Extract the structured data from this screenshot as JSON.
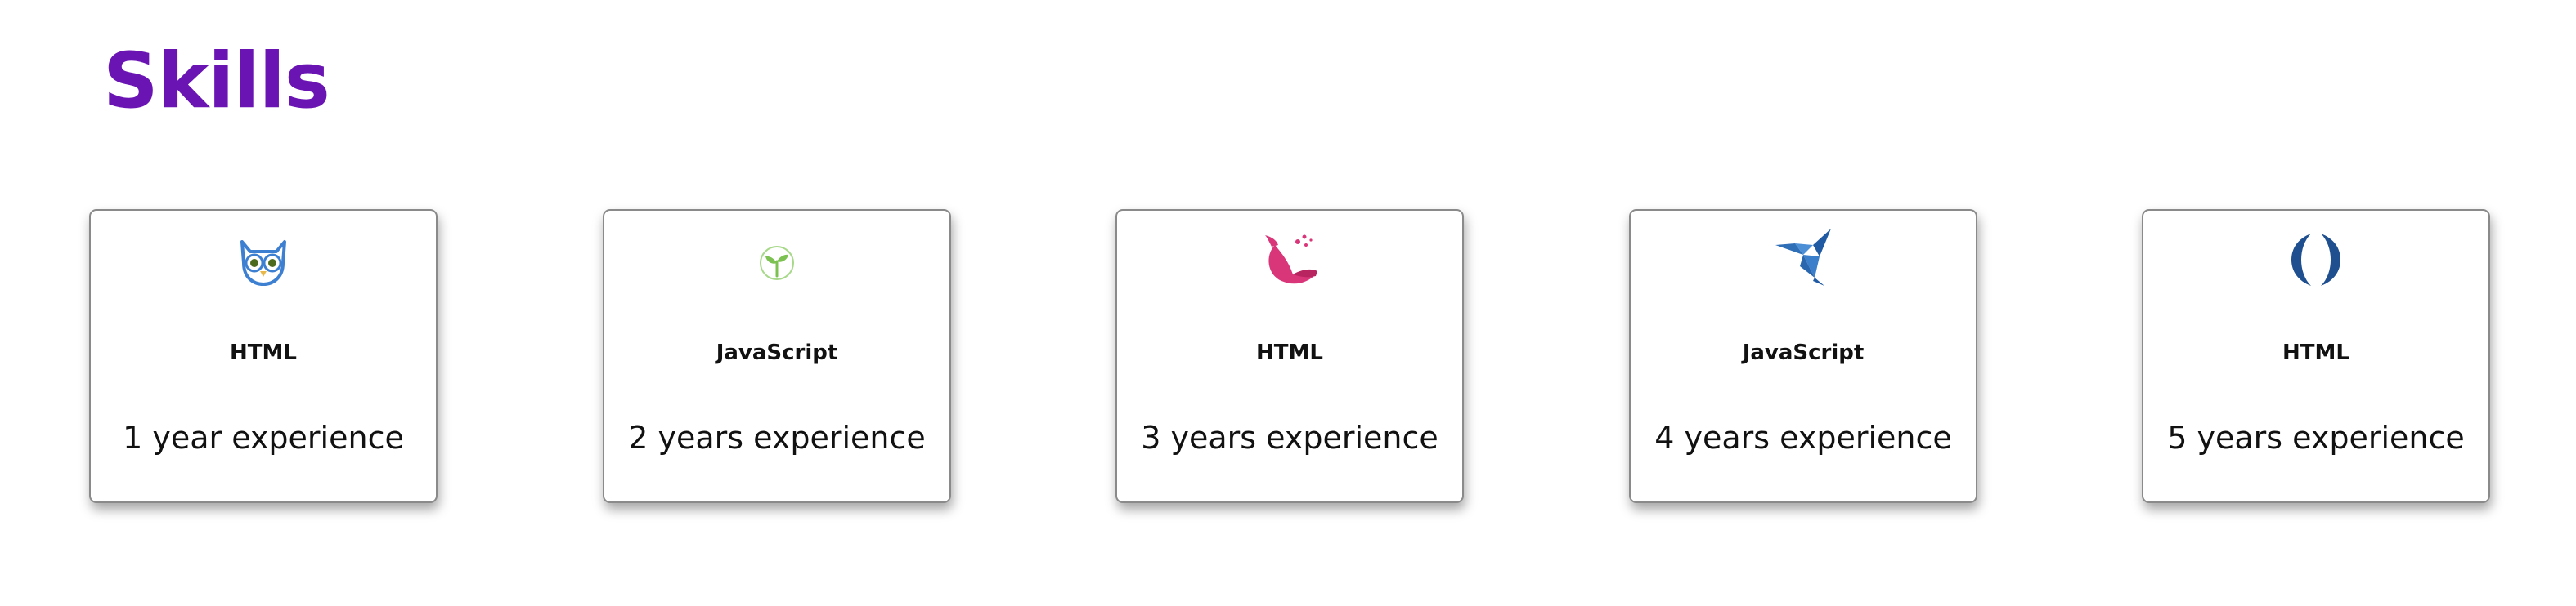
{
  "page": {
    "title": "Skills",
    "title_color": "#6a14b4"
  },
  "cards": [
    {
      "icon": "owl-icon",
      "skill": "HTML",
      "experience": "1 year experience"
    },
    {
      "icon": "sprout-icon",
      "skill": "JavaScript",
      "experience": "2 years experience"
    },
    {
      "icon": "whale-icon",
      "skill": "HTML",
      "experience": "3 years experience"
    },
    {
      "icon": "origami-bird-icon",
      "skill": "JavaScript",
      "experience": "4 years experience"
    },
    {
      "icon": "parentheses-icon",
      "skill": "HTML",
      "experience": "5 years experience"
    }
  ]
}
